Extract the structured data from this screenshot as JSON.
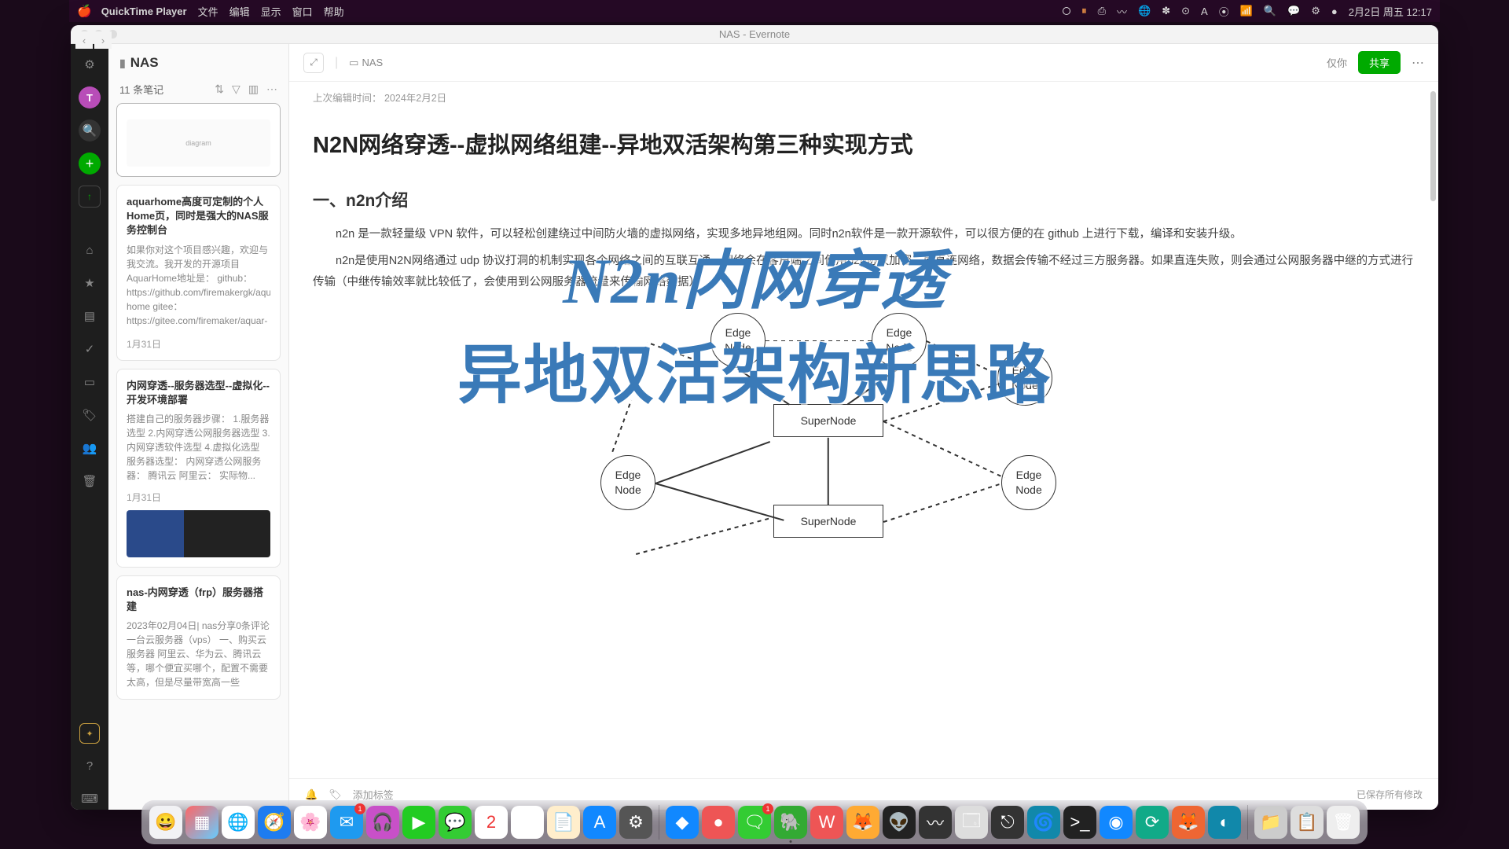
{
  "menubar": {
    "app": "QuickTime Player",
    "items": [
      "文件",
      "编辑",
      "显示",
      "窗口",
      "帮助"
    ],
    "datetime": "2月2日 周五  12:17"
  },
  "window": {
    "title": "NAS - Evernote"
  },
  "rail": {
    "avatar": "T"
  },
  "notelist": {
    "title": "NAS",
    "count": "11 条笔记",
    "cards": [
      {
        "title": "",
        "body": "",
        "date": "",
        "thumb": "diagram"
      },
      {
        "title": "aquarhome高度可定制的个人Home页，同时是强大的NAS服务控制台",
        "body": "如果你对这个项目感兴趣，欢迎与我交流。我开发的开源项目AquarHome地址是： github：https://github.com/firemakergk/aquar-home gitee：https://gitee.com/firemaker/aquar-home 帮助文档地址：...",
        "date": "1月31日"
      },
      {
        "title": "内网穿透--服务器选型--虚拟化--开发环境部署",
        "body": "搭建自己的服务器步骤： 1.服务器选型 2.内网穿透公网服务器选型 3.内网穿透软件选型 4.虚拟化选型 服务器选型： 内网穿透公网服务器： 腾讯云 阿里云： 实际物...",
        "date": "1月31日",
        "thumb": "server"
      },
      {
        "title": "nas-内网穿透（frp）服务器搭建",
        "body": "2023年02月04日| nas分享0条评论 一台云服务器（vps） 一、购买云服务器 阿里云、华为云、腾讯云等，哪个便宜买哪个，配置不需要太高，但是尽量带宽高一些",
        "date": ""
      }
    ]
  },
  "editor": {
    "breadcrumb": "NAS",
    "only_you": "仅你",
    "share": "共享",
    "meta": "上次编辑时间：  2024年2月2日",
    "title": "N2N网络穿透--虚拟网络组建--异地双活架构第三种实现方式",
    "h2": "一、n2n介绍",
    "p1": "n2n 是一款轻量级 VPN 软件，可以轻松创建绕过中间防火墙的虚拟网络，实现多地异地组网。同时n2n软件是一款开源软件，可以很方便的在 github 上进行下载，编译和安装升级。",
    "p2": "n2n是使用N2N网络通过 udp 协议打洞的机制实现各个网络之间的互联互通，网络会在客户端之间使用p2p协议加密二层直连网络，数据会传输不经过三方服务器。如果直连失败，则会通过公网服务器中继的方式进行传输（中继传输效率就比较低了，会使用到公网服务器流量来传输网络数据）。",
    "add_tag": "添加标签",
    "saved": "已保存所有修改"
  },
  "diagram": {
    "nodes": {
      "edge1": "Edge\nNode",
      "edge2": "Edge\nNode",
      "edge3": "Edge\nNode",
      "edge4": "Edge\nNode",
      "edge5": "Edge\nNode",
      "super1": "SuperNode",
      "super2": "SuperNode"
    }
  },
  "overlay": {
    "line1": "N2n内网穿透",
    "line2": "异地双活架构新思路"
  },
  "dock": {
    "items": [
      {
        "c": "#f2f2f5",
        "t": "😀"
      },
      {
        "c": "linear-gradient(135deg,#f66,#6cf)",
        "t": "▦"
      },
      {
        "c": "#fff",
        "t": "🌐"
      },
      {
        "c": "#1e7cf0",
        "t": "🧭"
      },
      {
        "c": "#fff",
        "t": "🌸"
      },
      {
        "c": "#1e9af0",
        "t": "✉",
        "b": "1"
      },
      {
        "c": "#c850c8",
        "t": "🎧"
      },
      {
        "c": "#2c2",
        "t": "▶"
      },
      {
        "c": "#3c3",
        "t": "💬"
      },
      {
        "c": "#fff",
        "t": "2",
        "txt": "#e33"
      },
      {
        "c": "#fff",
        "t": "☰"
      },
      {
        "c": "#fec",
        "t": "📄"
      },
      {
        "c": "#18f",
        "t": "A"
      },
      {
        "c": "#555",
        "t": "⚙"
      },
      {
        "c": "#18f",
        "t": "◆"
      },
      {
        "c": "#e55",
        "t": "●"
      },
      {
        "c": "#3c3",
        "t": "🗨",
        "b": "1"
      },
      {
        "c": "#3a3",
        "t": "🐘",
        "dot": true
      },
      {
        "c": "#e55",
        "t": "W"
      },
      {
        "c": "#fa3",
        "t": "🦊"
      },
      {
        "c": "#222",
        "t": "👽"
      },
      {
        "c": "#333",
        "t": "〰"
      },
      {
        "c": "#ddd",
        "t": "🗔"
      },
      {
        "c": "#333",
        "t": "⎋"
      },
      {
        "c": "#18a",
        "t": "🌀"
      },
      {
        "c": "#222",
        "t": ">_"
      },
      {
        "c": "#18f",
        "t": "◉"
      },
      {
        "c": "#1a8",
        "t": "⟳"
      },
      {
        "c": "#e63",
        "t": "🦊"
      },
      {
        "c": "#18a",
        "t": "◐"
      },
      {
        "c": "#ccc",
        "t": "📁"
      },
      {
        "c": "#ddd",
        "t": "📋"
      },
      {
        "c": "#eee",
        "t": "🗑"
      }
    ],
    "seps": [
      14,
      30
    ]
  }
}
